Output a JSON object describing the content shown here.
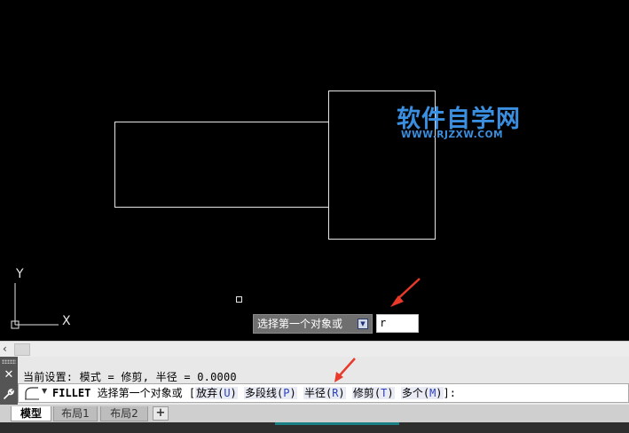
{
  "canvas": {
    "background": "#000000",
    "ucs_labels": {
      "y": "Y",
      "x": "X"
    },
    "watermark": {
      "title": "软件自学网",
      "url": "WWW.RJZXW.COM",
      "color": "#3a8fe0"
    },
    "dynamic_input": {
      "prompt": "选择第一个对象或",
      "value": "r"
    }
  },
  "command_panel": {
    "history_line": "当前设置: 模式 = 修剪, 半径 = 0.0000",
    "command_name": "FILLET",
    "prompt": "选择第一个对象或",
    "bracket_open": "[",
    "bracket_close": "]:",
    "options": [
      {
        "label": "放弃(",
        "key": "U",
        "tail": ")"
      },
      {
        "label": "多段线(",
        "key": "P",
        "tail": ")"
      },
      {
        "label": "半径(",
        "key": "R",
        "tail": ")"
      },
      {
        "label": "修剪(",
        "key": "T",
        "tail": ")"
      },
      {
        "label": "多个(",
        "key": "M",
        "tail": ")"
      }
    ]
  },
  "scrollbar": {
    "arrow": "‹"
  },
  "tabs": [
    {
      "label": "模型",
      "active": true
    },
    {
      "label": "布局1",
      "active": false
    },
    {
      "label": "布局2",
      "active": false
    }
  ],
  "tab_add": "+",
  "accent_arrow_color": "#e8392a"
}
